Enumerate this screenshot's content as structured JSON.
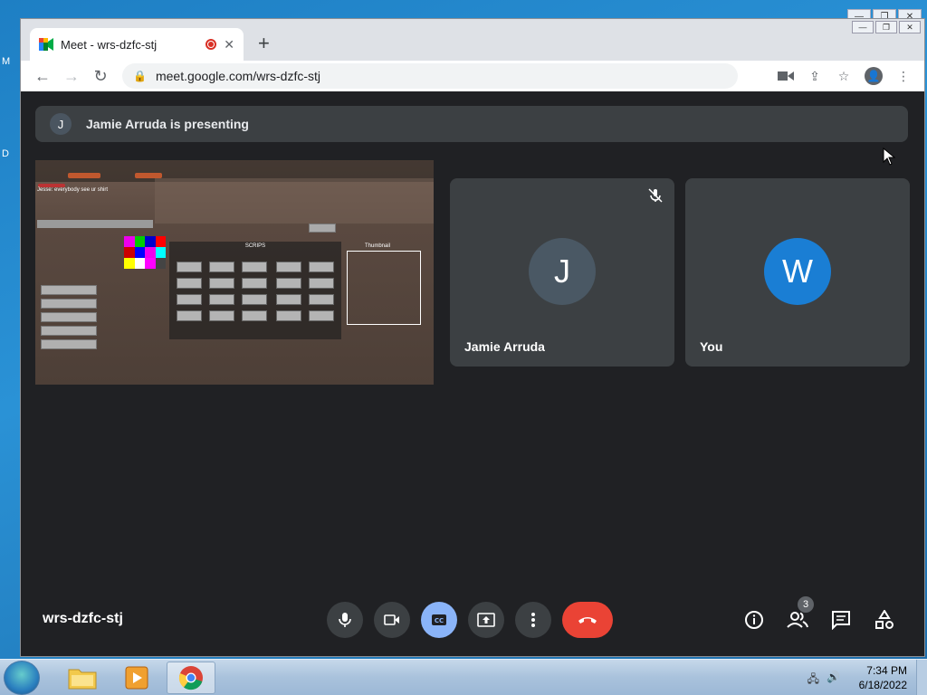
{
  "desktop": {
    "edge_letters": [
      "M",
      "D"
    ]
  },
  "browser": {
    "tab_title": "Meet - wrs-dzfc-stj",
    "url": "meet.google.com/wrs-dzfc-stj"
  },
  "meet": {
    "presenter_initial": "J",
    "presenting_text": "Jamie Arruda is presenting",
    "shared_screen": {
      "chat_line": "Jesse: everybody see ur shirt",
      "scripts_title": "SCRIPS",
      "thumb_title": "Thumbnail"
    },
    "participants": [
      {
        "initial": "J",
        "name": "Jamie Arruda",
        "muted": true,
        "color": "#4a5864"
      },
      {
        "initial": "W",
        "name": "You",
        "muted": false,
        "color": "#1a7ed4"
      }
    ],
    "meeting_code": "wrs-dzfc-stj",
    "people_count": "3"
  },
  "taskbar": {
    "time": "7:34 PM",
    "date": "6/18/2022"
  },
  "colors": {
    "leave_red": "#ea4335",
    "cc_blue": "#8ab4f8",
    "meet_bg": "#202124",
    "tile_bg": "#3c4043"
  }
}
